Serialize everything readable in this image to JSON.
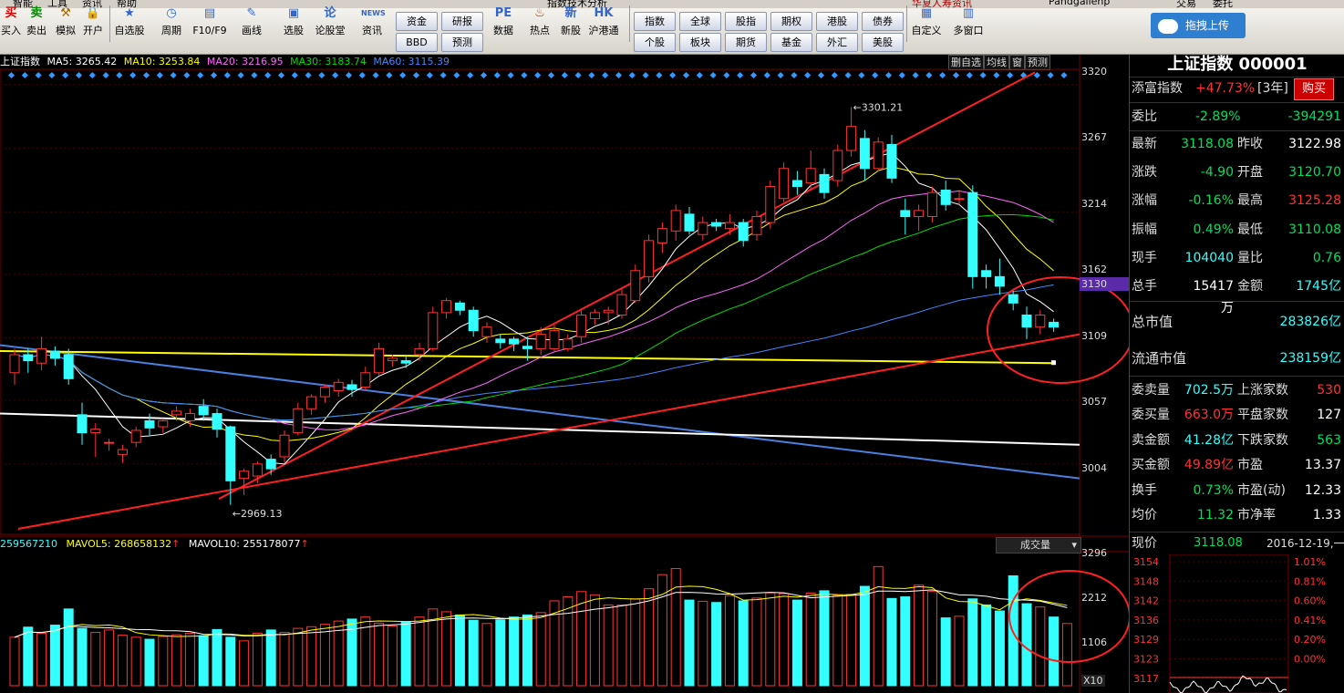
{
  "menu": {
    "items": [
      "智能",
      "工具",
      "资讯",
      "帮助"
    ],
    "center": "指数技术分析",
    "right1": "华夏人寿资讯",
    "right2": "Pandgallenp",
    "right3": "交易",
    "right4": "委托"
  },
  "toolbar": {
    "buttons": [
      {
        "label": "买入",
        "icon": "买",
        "color": "#d00"
      },
      {
        "label": "卖出",
        "icon": "卖",
        "color": "#080"
      },
      {
        "label": "模拟",
        "icon": "⚒",
        "color": "#a60"
      },
      {
        "label": "开户",
        "icon": "🔒",
        "color": "#a60"
      },
      {
        "label": "自选股",
        "icon": "★",
        "color": "#36c"
      },
      {
        "label": "周期",
        "icon": "◷",
        "color": "#36c"
      },
      {
        "label": "F10/F9",
        "icon": "▤",
        "color": "#36c"
      },
      {
        "label": "画线",
        "icon": "✎",
        "color": "#36c"
      },
      {
        "label": "选股",
        "icon": "▣",
        "color": "#36c"
      },
      {
        "label": "论股堂",
        "icon": "论",
        "color": "#36c"
      },
      {
        "label": "资讯",
        "icon": "NEWS",
        "color": "#36c"
      }
    ],
    "small_a": [
      "资金",
      "研报",
      "BBD",
      "预测"
    ],
    "buttons2": [
      {
        "label": "数据",
        "icon": "PE",
        "color": "#36c"
      },
      {
        "label": "热点",
        "icon": "♨",
        "color": "#c30"
      },
      {
        "label": "新股",
        "icon": "新",
        "color": "#36c"
      },
      {
        "label": "沪港通",
        "icon": "HK",
        "color": "#36c"
      }
    ],
    "small_b": [
      "指数",
      "全球",
      "股指",
      "期权",
      "港股",
      "债券",
      "个股",
      "板块",
      "期货",
      "基金",
      "外汇",
      "美股"
    ],
    "buttons3": [
      {
        "label": "自定义",
        "icon": "▦",
        "color": "#36c"
      },
      {
        "label": "多窗口",
        "icon": "▥",
        "color": "#36c"
      }
    ],
    "upload_label": "拖拽上传"
  },
  "main_header": {
    "name": "上证指数",
    "ma5": "MA5: 3265.42",
    "ma10": "MA10: 3253.84",
    "ma20": "MA20: 3216.95",
    "ma30": "MA30: 3183.74",
    "ma60": "MA60: 3115.39",
    "controls": [
      "删自选",
      "均线",
      "窗",
      "预测"
    ]
  },
  "colors": {
    "ma5": "#ffffff",
    "ma10": "#ffff00",
    "ma20": "#ff66ff",
    "ma30": "#00dd00",
    "ma60": "#4488ff",
    "up": "#ff3333",
    "down": "#33ffff",
    "trendline": "#ff2020",
    "circle": "#ff2020"
  },
  "price_axis": {
    "ticks": [
      "3320",
      "3267",
      "3214",
      "3162",
      "3109",
      "3057",
      "3004"
    ],
    "current_marker": "3130"
  },
  "annotations": {
    "high": "3301.21",
    "low": "2969.13"
  },
  "volume_header": {
    "vol": "259567210",
    "mavol5": "MAVOL5: 268658132",
    "mavol10": "MAVOL10: 255178077",
    "select": "成交量"
  },
  "volume_axis": {
    "ticks": [
      "3296",
      "2212",
      "1106"
    ],
    "unit": "X10"
  },
  "chart_data": {
    "type": "candlestick",
    "title": "上证指数",
    "ylim": [
      2950,
      3325
    ],
    "candles": [
      [
        3080,
        3095,
        3070,
        3100
      ],
      [
        3095,
        3090,
        3080,
        3100
      ],
      [
        3088,
        3100,
        3082,
        3110
      ],
      [
        3098,
        3092,
        3086,
        3102
      ],
      [
        3095,
        3075,
        3070,
        3100
      ],
      [
        3045,
        3030,
        3020,
        3055
      ],
      [
        3030,
        3033,
        3010,
        3038
      ],
      [
        3022,
        3022,
        3015,
        3025
      ],
      [
        3012,
        3016,
        3005,
        3020
      ],
      [
        3022,
        3032,
        3018,
        3035
      ],
      [
        3040,
        3034,
        3028,
        3046
      ],
      [
        3035,
        3040,
        3030,
        3042
      ],
      [
        3045,
        3048,
        3040,
        3052
      ],
      [
        3040,
        3046,
        3035,
        3050
      ],
      [
        3052,
        3045,
        3040,
        3058
      ],
      [
        3046,
        3033,
        3026,
        3050
      ],
      [
        3035,
        2990,
        2970,
        3036
      ],
      [
        2992,
        2998,
        2978,
        3000
      ],
      [
        2994,
        3004,
        2988,
        3006
      ],
      [
        3008,
        3000,
        2995,
        3012
      ],
      [
        3010,
        3028,
        3005,
        3032
      ],
      [
        3030,
        3050,
        3028,
        3055
      ],
      [
        3050,
        3060,
        3045,
        3062
      ],
      [
        3060,
        3068,
        3055,
        3070
      ],
      [
        3065,
        3072,
        3060,
        3075
      ],
      [
        3070,
        3066,
        3060,
        3074
      ],
      [
        3068,
        3080,
        3065,
        3085
      ],
      [
        3080,
        3100,
        3078,
        3105
      ],
      [
        3090,
        3092,
        3085,
        3095
      ],
      [
        3090,
        3088,
        3084,
        3094
      ],
      [
        3095,
        3100,
        3090,
        3105
      ],
      [
        3100,
        3130,
        3098,
        3135
      ],
      [
        3130,
        3140,
        3125,
        3142
      ],
      [
        3138,
        3132,
        3128,
        3140
      ],
      [
        3132,
        3115,
        3110,
        3135
      ],
      [
        3110,
        3118,
        3105,
        3122
      ],
      [
        3108,
        3105,
        3100,
        3112
      ],
      [
        3108,
        3104,
        3098,
        3110
      ],
      [
        3102,
        3100,
        3090,
        3110
      ],
      [
        3100,
        3112,
        3095,
        3118
      ],
      [
        3100,
        3115,
        3098,
        3120
      ],
      [
        3100,
        3108,
        3098,
        3112
      ],
      [
        3110,
        3128,
        3105,
        3132
      ],
      [
        3125,
        3130,
        3120,
        3133
      ],
      [
        3130,
        3132,
        3120,
        3135
      ],
      [
        3128,
        3145,
        3125,
        3150
      ],
      [
        3140,
        3165,
        3138,
        3170
      ],
      [
        3160,
        3190,
        3155,
        3195
      ],
      [
        3188,
        3200,
        3180,
        3205
      ],
      [
        3198,
        3215,
        3190,
        3220
      ],
      [
        3212,
        3198,
        3195,
        3218
      ],
      [
        3195,
        3205,
        3190,
        3210
      ],
      [
        3205,
        3202,
        3198,
        3208
      ],
      [
        3200,
        3205,
        3195,
        3212
      ],
      [
        3205,
        3190,
        3185,
        3208
      ],
      [
        3195,
        3210,
        3190,
        3215
      ],
      [
        3205,
        3235,
        3200,
        3240
      ],
      [
        3225,
        3250,
        3222,
        3255
      ],
      [
        3240,
        3235,
        3228,
        3248
      ],
      [
        3238,
        3250,
        3232,
        3265
      ],
      [
        3245,
        3230,
        3225,
        3250
      ],
      [
        3240,
        3265,
        3235,
        3270
      ],
      [
        3265,
        3285,
        3260,
        3301.21
      ],
      [
        3275,
        3250,
        3240,
        3282
      ],
      [
        3250,
        3272,
        3248,
        3276
      ],
      [
        3270,
        3242,
        3238,
        3278
      ],
      [
        3215,
        3210,
        3195,
        3225
      ],
      [
        3210,
        3215,
        3198,
        3220
      ],
      [
        3210,
        3230,
        3205,
        3235
      ],
      [
        3232,
        3220,
        3215,
        3240
      ],
      [
        3225,
        3225,
        3220,
        3232
      ],
      [
        3230,
        3160,
        3150,
        3236
      ],
      [
        3165,
        3160,
        3150,
        3170
      ],
      [
        3160,
        3152,
        3145,
        3175
      ],
      [
        3145,
        3138,
        3132,
        3150
      ],
      [
        3128,
        3118,
        3108,
        3135
      ],
      [
        3118,
        3128,
        3112,
        3132
      ],
      [
        3122,
        3118,
        3114,
        3125
      ]
    ],
    "volume_max": 3296,
    "volumes": [
      1200,
      1450,
      1300,
      1500,
      1900,
      1420,
      1320,
      1380,
      1250,
      1200,
      1150,
      1220,
      1260,
      1300,
      1240,
      1390,
      1200,
      1110,
      1300,
      1380,
      1320,
      1420,
      1460,
      1520,
      1600,
      1650,
      1700,
      1550,
      1480,
      1570,
      1700,
      1900,
      1830,
      1750,
      1620,
      1540,
      1630,
      1700,
      1750,
      1810,
      2100,
      2200,
      2330,
      2250,
      2000,
      2000,
      2150,
      2400,
      2750,
      2900,
      2120,
      2090,
      2060,
      2230,
      2100,
      2170,
      2300,
      2280,
      2120,
      2290,
      2350,
      2240,
      2260,
      2460,
      2950,
      2160,
      2200,
      2490,
      2340,
      1680,
      1720,
      2150,
      2000,
      1850,
      2720,
      2030,
      1950,
      1700,
      1540
    ],
    "series": [
      {
        "name": "MA5",
        "color": "#ffffff"
      },
      {
        "name": "MA10",
        "color": "#ffff00"
      },
      {
        "name": "MA20",
        "color": "#ff66ff"
      },
      {
        "name": "MA30",
        "color": "#00dd00"
      },
      {
        "name": "MA60",
        "color": "#4488ff"
      }
    ]
  },
  "right_panel": {
    "title": "上证指数 000001",
    "tfzs": {
      "label": "添富指数",
      "value": "+47.73%",
      "period": "[3年]",
      "buy": "购买"
    },
    "weibi": {
      "label": "委比",
      "pct": "-2.89%",
      "val": "-394291"
    },
    "rows": [
      {
        "l1": "最新",
        "v1": "3118.08",
        "l2": "昨收",
        "v2": "3122.98",
        "c1": "grn",
        "c2": "wt"
      },
      {
        "l1": "涨跌",
        "v1": "-4.90",
        "l2": "开盘",
        "v2": "3120.70",
        "c1": "grn",
        "c2": "grn"
      },
      {
        "l1": "涨幅",
        "v1": "-0.16%",
        "l2": "最高",
        "v2": "3125.28",
        "c1": "grn",
        "c2": "red"
      },
      {
        "l1": "振幅",
        "v1": "0.49%",
        "l2": "最低",
        "v2": "3110.08",
        "c1": "grn",
        "c2": "grn"
      },
      {
        "l1": "现手",
        "v1": "104040",
        "l2": "量比",
        "v2": "0.76",
        "c1": "cy",
        "c2": "grn"
      },
      {
        "l1": "总手",
        "v1": "15417万",
        "l2": "金额",
        "v2": "1745亿",
        "c1": "wt",
        "c2": "cy"
      }
    ],
    "zsz": {
      "label": "总市值",
      "value": "283826亿"
    },
    "ltsz": {
      "label": "流通市值",
      "value": "238159亿"
    },
    "rows2": [
      {
        "l1": "委卖量",
        "v1": "702.5万",
        "l2": "上涨家数",
        "v2": "530",
        "c1": "cy",
        "c2": "red"
      },
      {
        "l1": "委买量",
        "v1": "663.0万",
        "l2": "平盘家数",
        "v2": "127",
        "c1": "red",
        "c2": "wt"
      },
      {
        "l1": "卖金额",
        "v1": "41.28亿",
        "l2": "下跌家数",
        "v2": "563",
        "c1": "cy",
        "c2": "grn"
      },
      {
        "l1": "买金额",
        "v1": "49.89亿",
        "l2": "市盈",
        "v2": "13.37",
        "c1": "red",
        "c2": "wt"
      },
      {
        "l1": "换手",
        "v1": "0.73%",
        "l2": "市盈(动)",
        "v2": "12.33",
        "c1": "grn",
        "c2": "wt"
      },
      {
        "l1": "均价",
        "v1": "11.32",
        "l2": "市净率",
        "v2": "1.33",
        "c1": "grn",
        "c2": "wt"
      }
    ],
    "now": {
      "label": "现价",
      "value": "3118.08",
      "date": "2016-12-19,一"
    },
    "mini_ticks_left": [
      "3154",
      "3148",
      "3142",
      "3136",
      "3129",
      "3123",
      "3117"
    ],
    "mini_ticks_right": [
      "1.01%",
      "0.81%",
      "0.60%",
      "0.41%",
      "0.20%",
      "0.00%",
      ""
    ]
  }
}
